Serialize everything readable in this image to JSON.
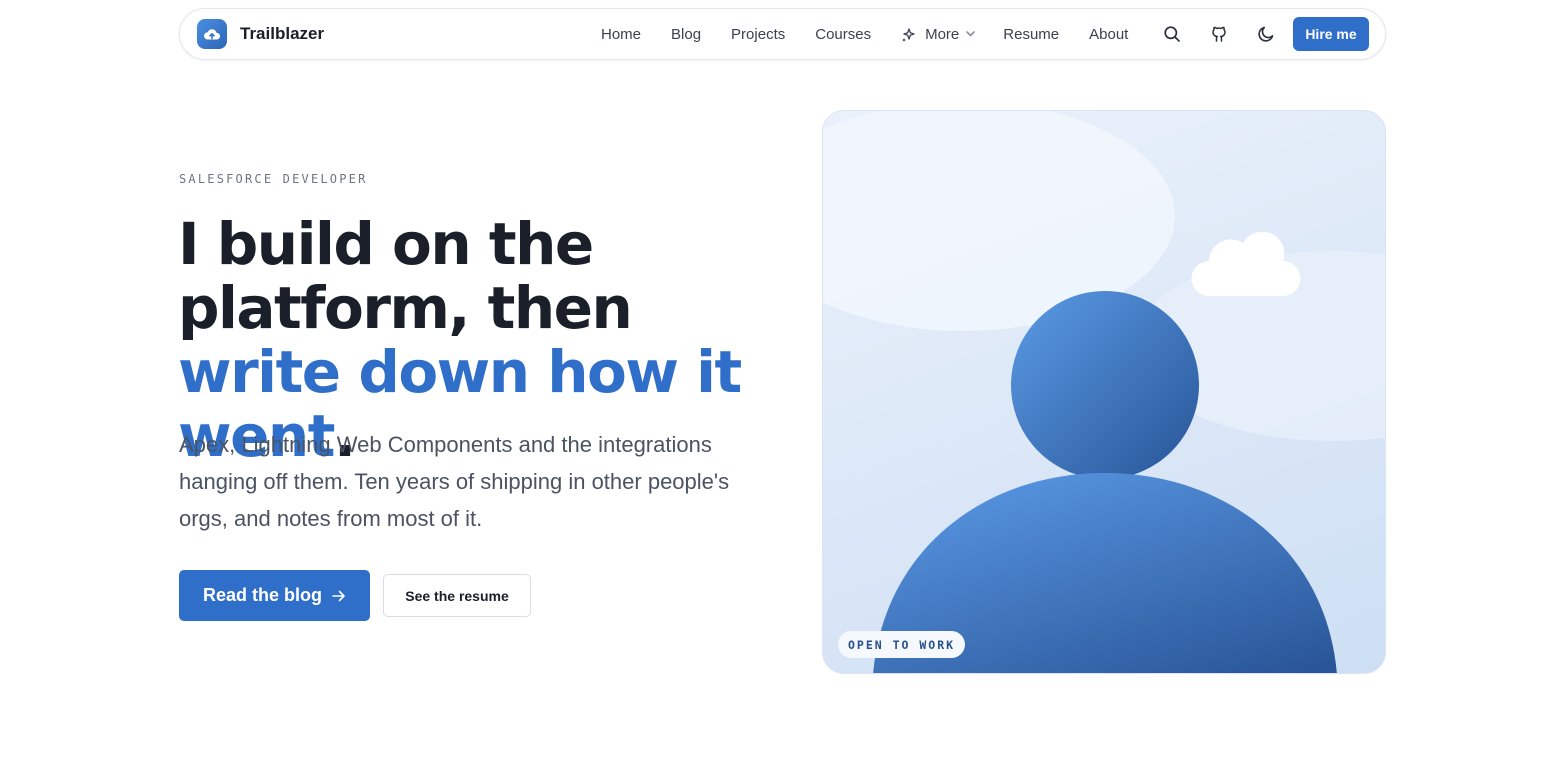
{
  "brand": {
    "name": "Trailblazer",
    "logo_icon": "cloud-icon"
  },
  "nav": {
    "links": [
      "Home",
      "Blog",
      "Projects",
      "Courses",
      "More",
      "Resume",
      "About"
    ],
    "icons": [
      "search-icon",
      "github-icon",
      "moon-icon"
    ],
    "hire_label": "Hire me"
  },
  "hero": {
    "eyebrow": "SALESFORCE DEVELOPER",
    "headline_plain": "I build on the platform, then ",
    "headline_accent": "write down how it went",
    "headline_end": ".",
    "lead": "Apex, Lightning Web Components and the integrations hanging off them. Ten years of shipping in other people's orgs, and notes from most of it.",
    "primary_cta": "Read the blog",
    "secondary_cta": "See the resume",
    "badge": "OPEN TO WORK"
  },
  "colors": {
    "accent": "#2f6fc9",
    "text": "#1b1f2a",
    "muted": "#4b5363"
  }
}
